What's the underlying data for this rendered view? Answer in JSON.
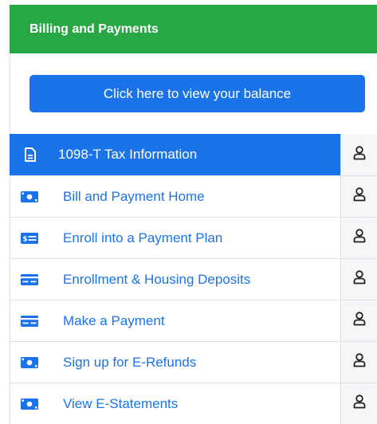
{
  "header": {
    "title": "Billing and Payments"
  },
  "balance_button": {
    "label": "Click here to view your balance"
  },
  "colors": {
    "header_green": "#27a844",
    "primary_blue": "#1a73e8",
    "side_gray": "#f5f6f7"
  },
  "menu": {
    "items": [
      {
        "label": "1098-T Tax Information",
        "icon": "document-icon",
        "active": true
      },
      {
        "label": "Bill and Payment Home",
        "icon": "money-bill-icon",
        "active": false
      },
      {
        "label": "Enroll into a Payment Plan",
        "icon": "money-check-icon",
        "active": false
      },
      {
        "label": "Enrollment & Housing Deposits",
        "icon": "credit-card-icon",
        "active": false
      },
      {
        "label": "Make a Payment",
        "icon": "credit-card-icon",
        "active": false
      },
      {
        "label": "Sign up for E-Refunds",
        "icon": "money-bill-icon",
        "active": false
      },
      {
        "label": "View E-Statements",
        "icon": "money-bill-icon",
        "active": false
      }
    ],
    "side_icon": "user-icon"
  }
}
